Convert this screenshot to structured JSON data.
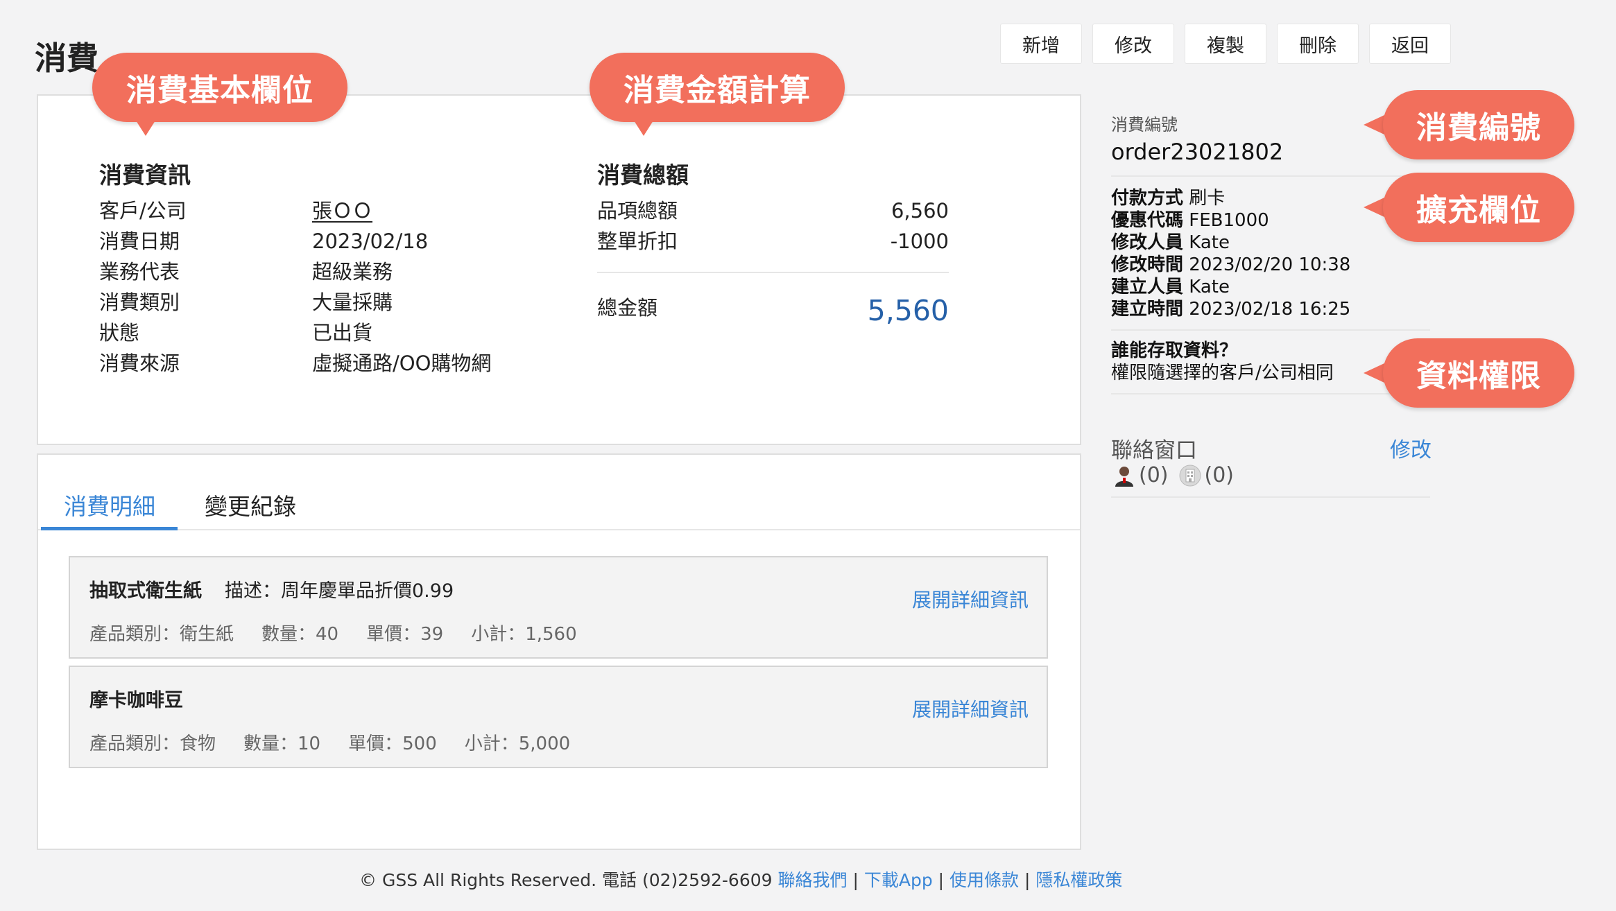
{
  "page": {
    "title": "消費"
  },
  "toolbar": {
    "add": "新增",
    "edit": "修改",
    "copy": "複製",
    "delete": "刪除",
    "back": "返回"
  },
  "callouts": {
    "basic": "消費基本欄位",
    "amount": "消費金額計算",
    "order_no": "消費編號",
    "extended": "擴充欄位",
    "permission": "資料權限"
  },
  "info": {
    "title": "消費資訊",
    "rows": [
      {
        "label": "客戶/公司",
        "value": "張ＯＯ"
      },
      {
        "label": "消費日期",
        "value": "2023/02/18"
      },
      {
        "label": "業務代表",
        "value": "超級業務"
      },
      {
        "label": "消費類別",
        "value": "大量採購"
      },
      {
        "label": "狀態",
        "value": "已出貨"
      },
      {
        "label": "消費來源",
        "value": "虛擬通路/OO購物網"
      }
    ]
  },
  "totals": {
    "title": "消費總額",
    "item_total_label": "品項總額",
    "item_total_value": "6,560",
    "discount_label": "整單折扣",
    "discount_value": "-1000",
    "grand_label": "總金額",
    "grand_value": "5,560"
  },
  "tabs": {
    "details": "消費明細",
    "history": "變更紀錄"
  },
  "items": [
    {
      "name": "抽取式衛生紙",
      "desc": "描述：周年慶單品折價0.99",
      "category": "產品類別：衛生紙",
      "qty": "數量：40",
      "price": "單價：39",
      "subtotal": "小計：1,560",
      "expand": "展開詳細資訊"
    },
    {
      "name": "摩卡咖啡豆",
      "desc": "",
      "category": "產品類別：食物",
      "qty": "數量：10",
      "price": "單價：500",
      "subtotal": "小計：5,000",
      "expand": "展開詳細資訊"
    }
  ],
  "sidebar": {
    "order_no_label": "消費編號",
    "order_no": "order23021802",
    "ext": [
      {
        "label": "付款方式",
        "value": "刷卡"
      },
      {
        "label": "優惠代碼",
        "value": "FEB1000"
      },
      {
        "label": "修改人員",
        "value": "Kate"
      },
      {
        "label": "修改時間",
        "value": "2023/02/20 10:38"
      },
      {
        "label": "建立人員",
        "value": "Kate"
      },
      {
        "label": "建立時間",
        "value": "2023/02/18 16:25"
      }
    ],
    "access_title": "誰能存取資料？",
    "access_desc": "權限隨選擇的客戶/公司相同",
    "contact_label": "聯絡窗口",
    "contact_edit": "修改",
    "person_count": "(0)",
    "company_count": "(0)"
  },
  "footer": {
    "copyright": "© GSS All Rights Reserved. 電話 (02)2592-6609",
    "contact": "聯絡我們",
    "app": "下載App",
    "terms": "使用條款",
    "privacy": "隱私權政策",
    "sep": "|"
  }
}
